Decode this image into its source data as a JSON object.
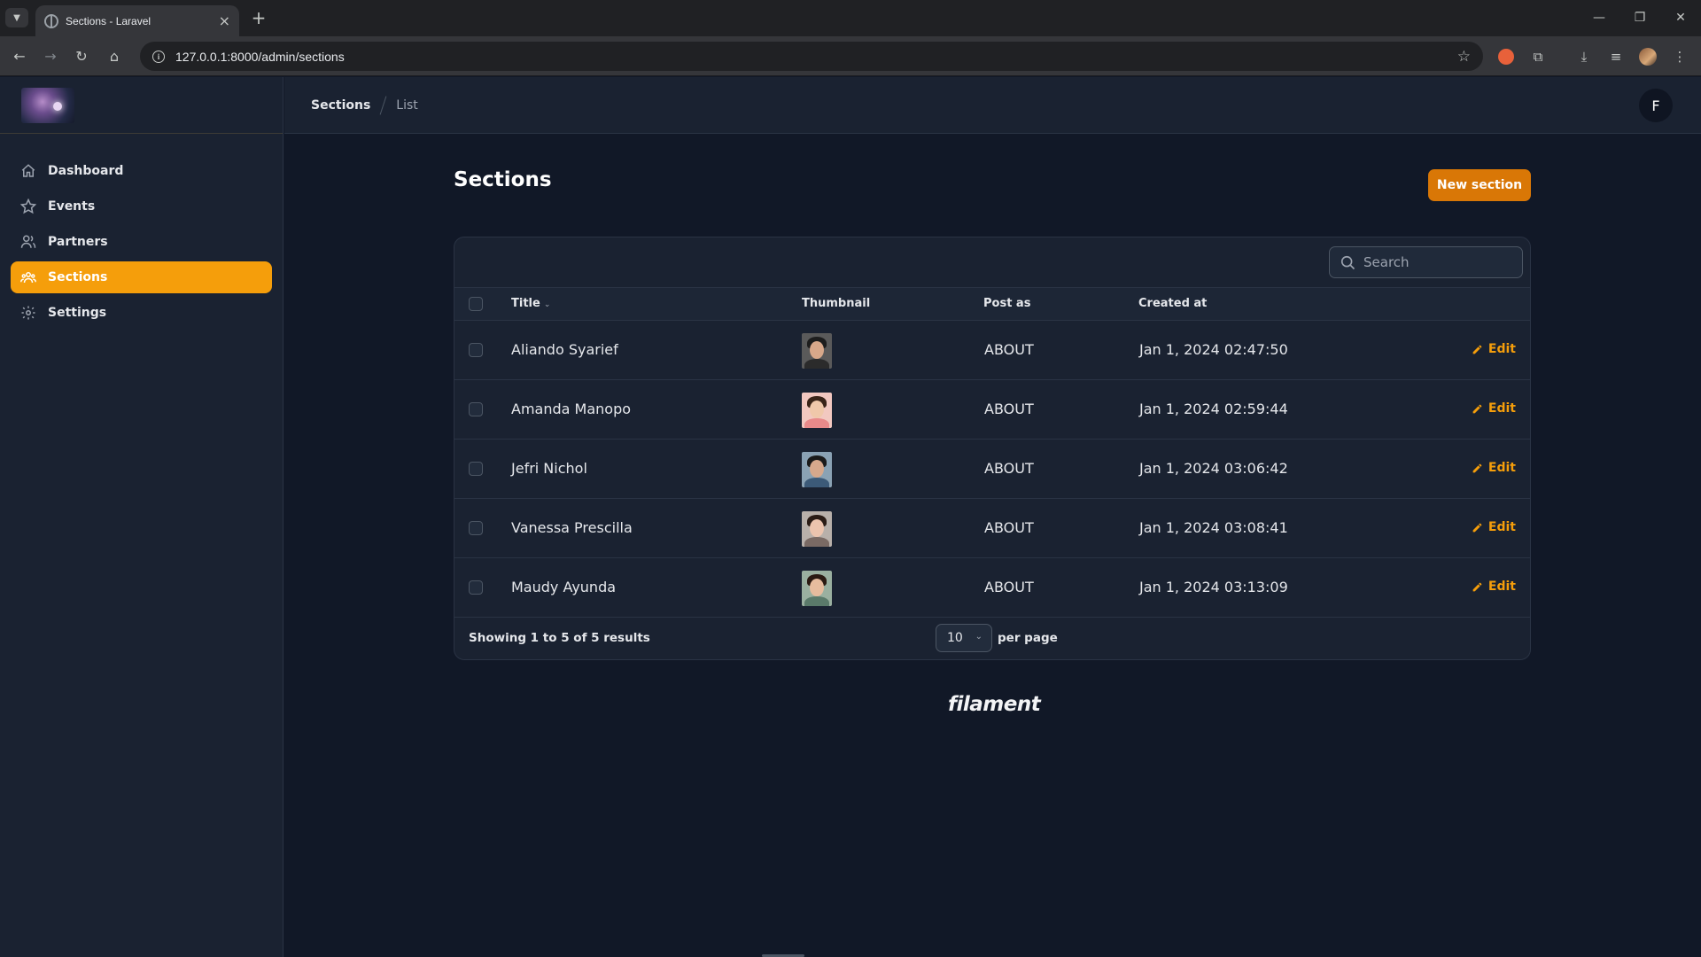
{
  "browser": {
    "tab_title": "Sections - Laravel",
    "url": "127.0.0.1:8000/admin/sections"
  },
  "sidebar": {
    "items": [
      {
        "label": "Dashboard",
        "icon": "home-icon",
        "active": false
      },
      {
        "label": "Events",
        "icon": "star-icon",
        "active": false
      },
      {
        "label": "Partners",
        "icon": "users-icon",
        "active": false
      },
      {
        "label": "Sections",
        "icon": "user-group-icon",
        "active": true
      },
      {
        "label": "Settings",
        "icon": "gear-icon",
        "active": false
      }
    ]
  },
  "breadcrumb": {
    "first": "Sections",
    "second": "List"
  },
  "user": {
    "initial": "F"
  },
  "page": {
    "title": "Sections",
    "new_button": "New section"
  },
  "search": {
    "placeholder": "Search"
  },
  "table": {
    "headers": {
      "title": "Title",
      "thumbnail": "Thumbnail",
      "post_as": "Post as",
      "created_at": "Created at"
    },
    "rows": [
      {
        "title": "Aliando Syarief",
        "post_as": "ABOUT",
        "created_at": "Jan 1, 2024 02:47:50",
        "edit": "Edit"
      },
      {
        "title": "Amanda Manopo",
        "post_as": "ABOUT",
        "created_at": "Jan 1, 2024 02:59:44",
        "edit": "Edit"
      },
      {
        "title": "Jefri Nichol",
        "post_as": "ABOUT",
        "created_at": "Jan 1, 2024 03:06:42",
        "edit": "Edit"
      },
      {
        "title": "Vanessa Prescilla",
        "post_as": "ABOUT",
        "created_at": "Jan 1, 2024 03:08:41",
        "edit": "Edit"
      },
      {
        "title": "Maudy Ayunda",
        "post_as": "ABOUT",
        "created_at": "Jan 1, 2024 03:13:09",
        "edit": "Edit"
      }
    ]
  },
  "pagination": {
    "showing": "Showing 1 to 5 of 5 results",
    "per_page_value": "10",
    "per_page_label": "per page"
  },
  "footer": {
    "brand": "filament"
  },
  "colors": {
    "accent": "#f59e0b",
    "background": "#111827",
    "panel": "#1a2231"
  }
}
